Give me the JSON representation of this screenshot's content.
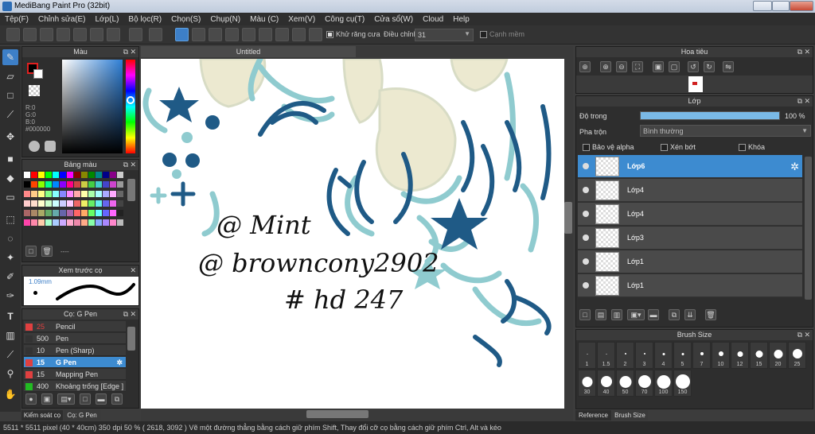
{
  "window": {
    "title": "MediBang Paint Pro (32bit)"
  },
  "menu": [
    "Tệp(F)",
    "Chỉnh sửa(E)",
    "Lớp(L)",
    "Bộ lọc(R)",
    "Chọn(S)",
    "Chụp(N)",
    "Màu (C)",
    "Xem(V)",
    "Công cụ(T)",
    "Cửa sổ(W)",
    "Cloud",
    "Help"
  ],
  "toolbar": {
    "antialias_label": "Khử răng cưa",
    "adjust_label": "Điều chỉnh",
    "adjust_value": "31",
    "edge_label": "Cạnh mềm"
  },
  "color_panel": {
    "title": "Màu",
    "r": "R:0",
    "g": "G:0",
    "b": "B:0",
    "hex": "#000000"
  },
  "palette_panel": {
    "title": "Bảng màu",
    "extra": "----"
  },
  "preview_panel": {
    "title": "Xem trước cọ",
    "size": "1.09mm"
  },
  "brush_panel": {
    "title": "Cọ: G Pen",
    "items": [
      {
        "size": "25",
        "name": "Pencil",
        "color": "#e04040"
      },
      {
        "size": "500",
        "name": "Pen",
        "color": "#333333"
      },
      {
        "size": "10",
        "name": "Pen (Sharp)",
        "color": "#333333"
      },
      {
        "size": "15",
        "name": "G Pen",
        "color": "#e04040"
      },
      {
        "size": "15",
        "name": "Mapping Pen",
        "color": "#e04040"
      },
      {
        "size": "400",
        "name": "Khoảng trống [Edge ]",
        "color": "#22bb22"
      }
    ]
  },
  "bottom_tabs": {
    "left": "Kiểm soát cọ",
    "right": "Cọ: G Pen"
  },
  "canvas": {
    "tab": "Untitled",
    "text_line1": "@ Mint",
    "text_line2": "@ browncony2902",
    "text_line3": "# hd 247"
  },
  "navigator": {
    "title": "Hoa tiêu"
  },
  "layer_panel": {
    "title": "Lớp",
    "opacity_label": "Độ trong",
    "opacity_value": "100 %",
    "opacity_fraction": 1.0,
    "blend_label": "Pha trộn",
    "blend_value": "Bình thường",
    "protect_alpha": "Bảo vệ alpha",
    "clipping": "Xén bớt",
    "lock": "Khóa",
    "layers": [
      "Lớp6",
      "Lớp4",
      "Lớp4",
      "Lớp3",
      "Lớp1",
      "Lớp1"
    ]
  },
  "brush_size_panel": {
    "title": "Brush Size",
    "sizes": [
      "1",
      "1.5",
      "2",
      "3",
      "4",
      "5",
      "7",
      "10",
      "12",
      "15",
      "20",
      "25",
      "30",
      "40",
      "50",
      "70",
      "100",
      "150"
    ]
  },
  "right_tabs": {
    "reference": "Reference",
    "brush_size": "Brush Size"
  },
  "status": {
    "dims": "5511 * 5511 pixel",
    "cm": "(40 * 40cm)",
    "dpi": "350 dpi",
    "zoom": "50 %",
    "coords": "( 2618, 3092 )",
    "hint": "Vẽ một đường thẳng bằng cách giữ phím Shift, Thay đổi cỡ cọ bằng cách giữ phím Ctrl, Alt và kéo"
  },
  "colors": {
    "accent": "#3d8bd0",
    "dark_blue": "#1f5a86",
    "teal": "#7cc4c8",
    "cream": "#ece9d0"
  }
}
